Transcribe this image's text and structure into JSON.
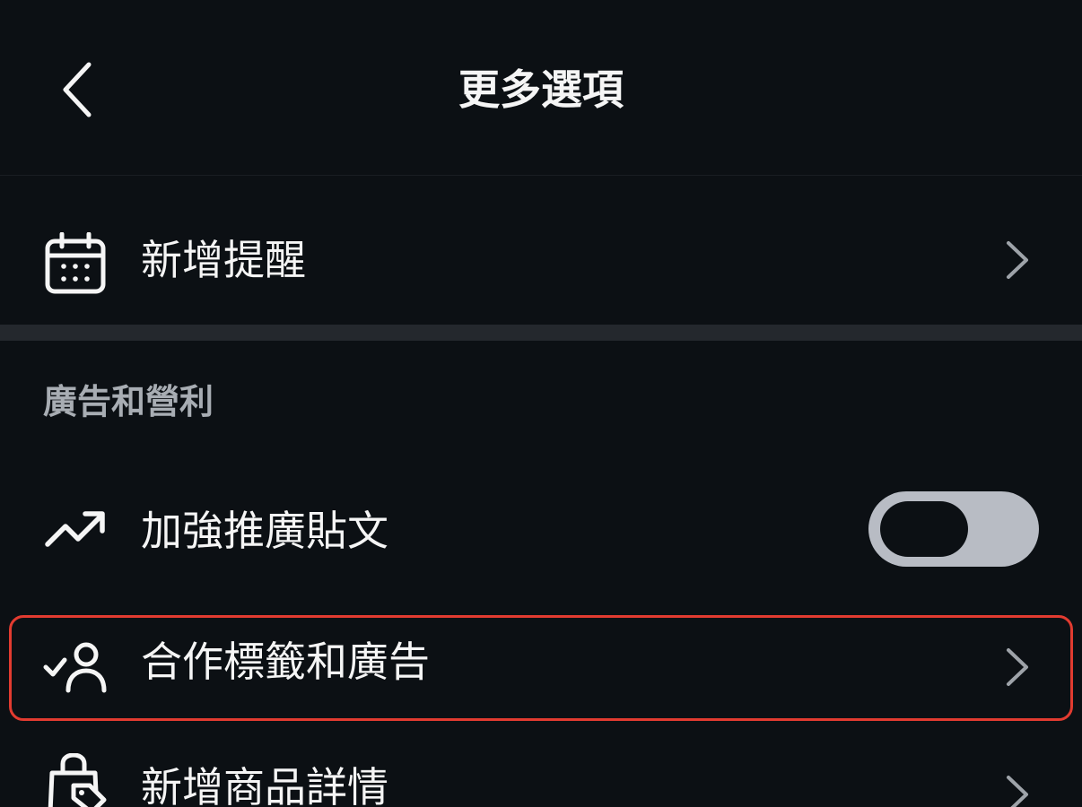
{
  "header": {
    "title": "更多選項"
  },
  "items": [
    {
      "label": "新增提醒",
      "icon": "calendar-icon",
      "control": "chevron"
    },
    {
      "label": "加強推廣貼文",
      "icon": "trending-up-icon",
      "control": "toggle",
      "toggle_on": false
    },
    {
      "label": "合作標籤和廣告",
      "icon": "user-check-icon",
      "control": "chevron"
    },
    {
      "label": "新增商品詳情",
      "icon": "shopping-bag-tag-icon",
      "control": "chevron"
    }
  ],
  "sections": {
    "ads_monetization": "廣告和營利"
  },
  "colors": {
    "background": "#0c1014",
    "text": "#f5f5f5",
    "secondary_text": "#a8adb3",
    "divider": "#24282d",
    "toggle_track": "#b8bcc4",
    "highlight": "#e23b30"
  }
}
